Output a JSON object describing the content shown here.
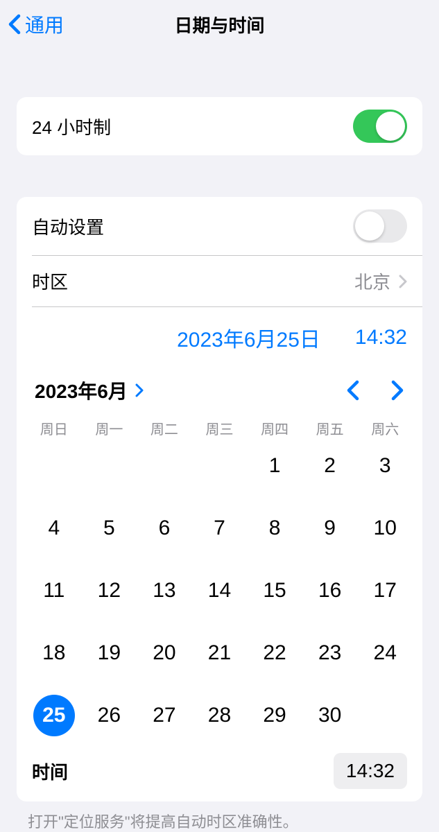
{
  "header": {
    "back_label": "通用",
    "title": "日期与时间"
  },
  "rows": {
    "twenty_four_hour_label": "24 小时制",
    "auto_set_label": "自动设置",
    "timezone_label": "时区",
    "timezone_value": "北京"
  },
  "datetime": {
    "date_display": "2023年6月25日",
    "time_display": "14:32"
  },
  "calendar": {
    "month_title": "2023年6月",
    "weekdays": [
      "周日",
      "周一",
      "周二",
      "周三",
      "周四",
      "周五",
      "周六"
    ],
    "leading_empty": 4,
    "days": [
      1,
      2,
      3,
      4,
      5,
      6,
      7,
      8,
      9,
      10,
      11,
      12,
      13,
      14,
      15,
      16,
      17,
      18,
      19,
      20,
      21,
      22,
      23,
      24,
      25,
      26,
      27,
      28,
      29,
      30
    ],
    "selected_day": 25
  },
  "time_row": {
    "label": "时间",
    "value": "14:32"
  },
  "footer": {
    "note": "打开\"定位服务\"将提高自动时区准确性。"
  },
  "toggles": {
    "twenty_four_hour": true,
    "auto_set": false
  }
}
